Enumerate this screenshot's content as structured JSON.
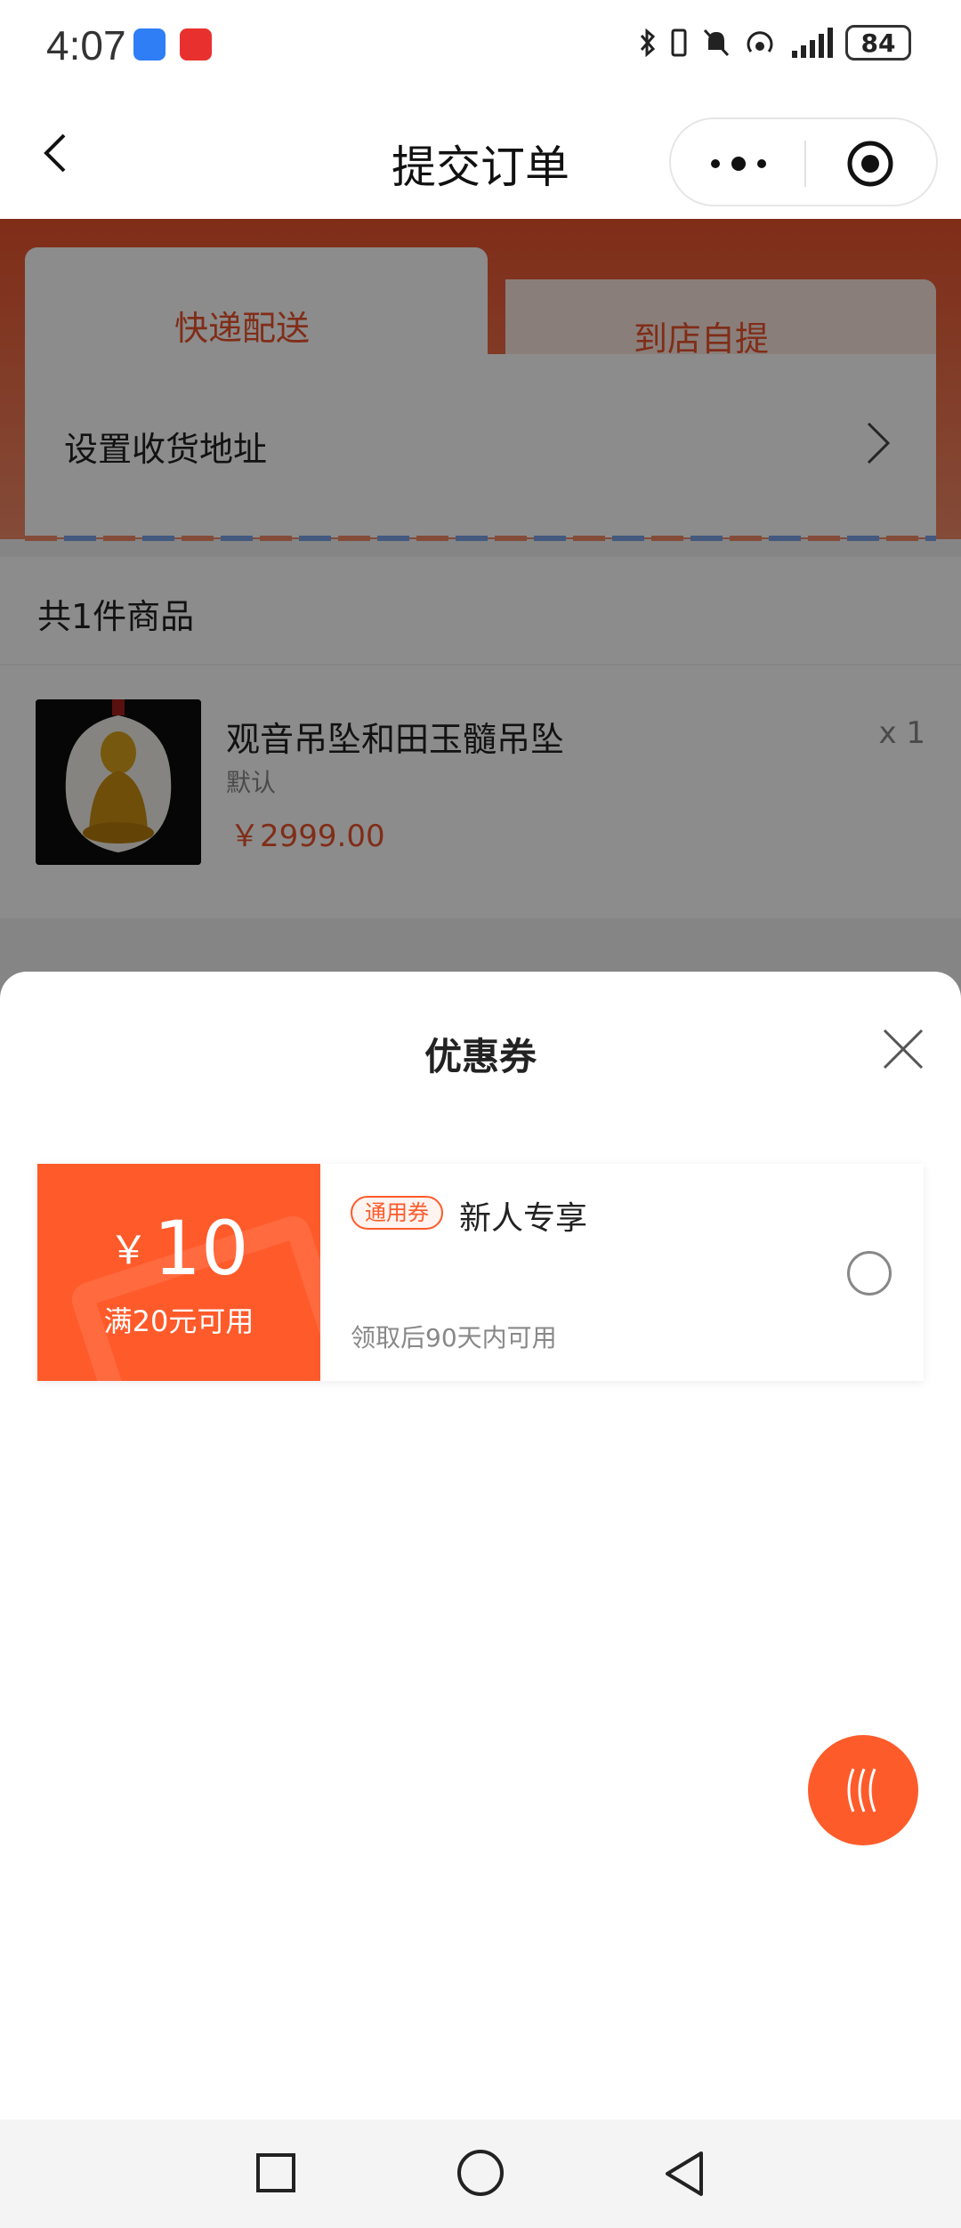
{
  "status_bar": {
    "time": "4:07",
    "battery": "84",
    "icons": [
      "bluetooth-icon",
      "vibrate-icon",
      "mute-icon",
      "hotspot-icon",
      "signal-icon",
      "battery-icon"
    ]
  },
  "nav": {
    "title": "提交订单",
    "icons": [
      "back-icon",
      "more-icon",
      "target-icon"
    ]
  },
  "delivery_tabs": {
    "active": "快递配送",
    "inactive": "到店自提"
  },
  "address": {
    "label": "设置收货地址"
  },
  "order": {
    "count_label": "共1件商品",
    "product": {
      "name": "观音吊坠和田玉髓吊坠",
      "variant": "默认",
      "price": "￥2999.00",
      "qty": "x 1"
    }
  },
  "coupon_sheet": {
    "title": "优惠券",
    "coupons": [
      {
        "currency": "￥",
        "amount": "10",
        "condition": "满20元可用",
        "badge": "通用券",
        "name": "新人专享",
        "validity": "领取后90天内可用",
        "selected": false
      }
    ]
  },
  "colors": {
    "accent": "#ff5a2a",
    "header_gradient_top": "#e9532c",
    "tab_inactive_bg": "#fce6de"
  }
}
